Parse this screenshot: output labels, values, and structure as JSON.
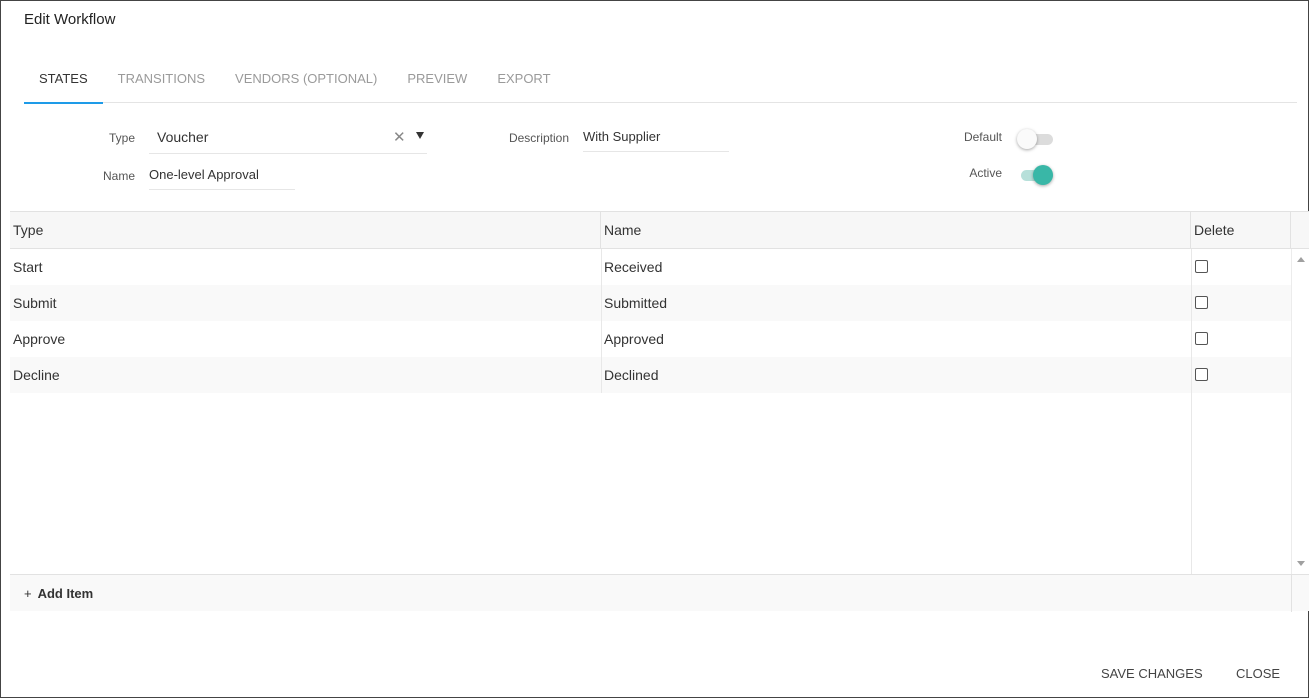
{
  "dialog": {
    "title": "Edit Workflow"
  },
  "tabs": [
    {
      "label": "STATES",
      "active": true
    },
    {
      "label": "TRANSITIONS",
      "active": false
    },
    {
      "label": "VENDORS (OPTIONAL)",
      "active": false
    },
    {
      "label": "PREVIEW",
      "active": false
    },
    {
      "label": "EXPORT",
      "active": false
    }
  ],
  "form": {
    "type_label": "Type",
    "type_value": "Voucher",
    "name_label": "Name",
    "name_value": "One-level Approval",
    "description_label": "Description",
    "description_value": "With Supplier",
    "default_label": "Default",
    "default_on": false,
    "active_label": "Active",
    "active_on": true
  },
  "table": {
    "columns": [
      "Type",
      "Name",
      "Delete"
    ],
    "rows": [
      {
        "type": "Start",
        "name": "Received",
        "delete": false
      },
      {
        "type": "Submit",
        "name": "Submitted",
        "delete": false
      },
      {
        "type": "Approve",
        "name": "Approved",
        "delete": false
      },
      {
        "type": "Decline",
        "name": "Declined",
        "delete": false
      }
    ],
    "add_item_label": "Add Item",
    "add_item_icon": "plus-icon"
  },
  "actions": {
    "save_label": "SAVE CHANGES",
    "close_label": "CLOSE"
  },
  "colors": {
    "tab_indicator": "#1e9be8",
    "toggle_on": "#39b7a7"
  }
}
